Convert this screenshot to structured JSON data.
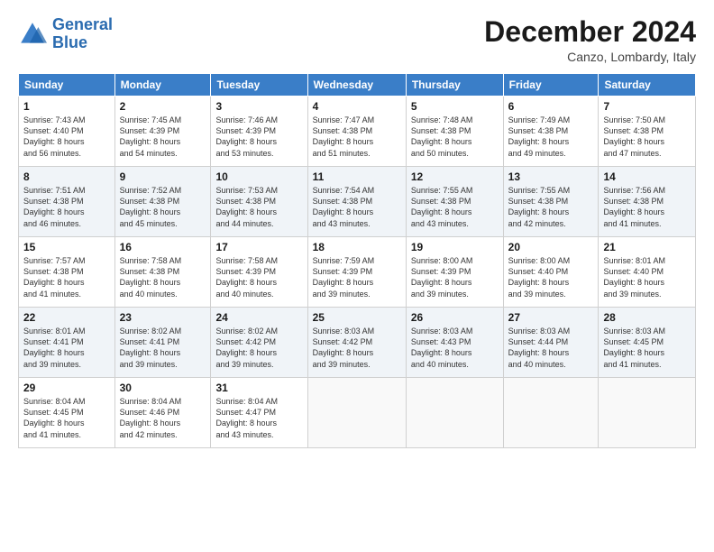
{
  "logo": {
    "line1": "General",
    "line2": "Blue"
  },
  "title": "December 2024",
  "location": "Canzo, Lombardy, Italy",
  "weekdays": [
    "Sunday",
    "Monday",
    "Tuesday",
    "Wednesday",
    "Thursday",
    "Friday",
    "Saturday"
  ],
  "weeks": [
    [
      {
        "day": "1",
        "info": "Sunrise: 7:43 AM\nSunset: 4:40 PM\nDaylight: 8 hours\nand 56 minutes."
      },
      {
        "day": "2",
        "info": "Sunrise: 7:45 AM\nSunset: 4:39 PM\nDaylight: 8 hours\nand 54 minutes."
      },
      {
        "day": "3",
        "info": "Sunrise: 7:46 AM\nSunset: 4:39 PM\nDaylight: 8 hours\nand 53 minutes."
      },
      {
        "day": "4",
        "info": "Sunrise: 7:47 AM\nSunset: 4:38 PM\nDaylight: 8 hours\nand 51 minutes."
      },
      {
        "day": "5",
        "info": "Sunrise: 7:48 AM\nSunset: 4:38 PM\nDaylight: 8 hours\nand 50 minutes."
      },
      {
        "day": "6",
        "info": "Sunrise: 7:49 AM\nSunset: 4:38 PM\nDaylight: 8 hours\nand 49 minutes."
      },
      {
        "day": "7",
        "info": "Sunrise: 7:50 AM\nSunset: 4:38 PM\nDaylight: 8 hours\nand 47 minutes."
      }
    ],
    [
      {
        "day": "8",
        "info": "Sunrise: 7:51 AM\nSunset: 4:38 PM\nDaylight: 8 hours\nand 46 minutes."
      },
      {
        "day": "9",
        "info": "Sunrise: 7:52 AM\nSunset: 4:38 PM\nDaylight: 8 hours\nand 45 minutes."
      },
      {
        "day": "10",
        "info": "Sunrise: 7:53 AM\nSunset: 4:38 PM\nDaylight: 8 hours\nand 44 minutes."
      },
      {
        "day": "11",
        "info": "Sunrise: 7:54 AM\nSunset: 4:38 PM\nDaylight: 8 hours\nand 43 minutes."
      },
      {
        "day": "12",
        "info": "Sunrise: 7:55 AM\nSunset: 4:38 PM\nDaylight: 8 hours\nand 43 minutes."
      },
      {
        "day": "13",
        "info": "Sunrise: 7:55 AM\nSunset: 4:38 PM\nDaylight: 8 hours\nand 42 minutes."
      },
      {
        "day": "14",
        "info": "Sunrise: 7:56 AM\nSunset: 4:38 PM\nDaylight: 8 hours\nand 41 minutes."
      }
    ],
    [
      {
        "day": "15",
        "info": "Sunrise: 7:57 AM\nSunset: 4:38 PM\nDaylight: 8 hours\nand 41 minutes."
      },
      {
        "day": "16",
        "info": "Sunrise: 7:58 AM\nSunset: 4:38 PM\nDaylight: 8 hours\nand 40 minutes."
      },
      {
        "day": "17",
        "info": "Sunrise: 7:58 AM\nSunset: 4:39 PM\nDaylight: 8 hours\nand 40 minutes."
      },
      {
        "day": "18",
        "info": "Sunrise: 7:59 AM\nSunset: 4:39 PM\nDaylight: 8 hours\nand 39 minutes."
      },
      {
        "day": "19",
        "info": "Sunrise: 8:00 AM\nSunset: 4:39 PM\nDaylight: 8 hours\nand 39 minutes."
      },
      {
        "day": "20",
        "info": "Sunrise: 8:00 AM\nSunset: 4:40 PM\nDaylight: 8 hours\nand 39 minutes."
      },
      {
        "day": "21",
        "info": "Sunrise: 8:01 AM\nSunset: 4:40 PM\nDaylight: 8 hours\nand 39 minutes."
      }
    ],
    [
      {
        "day": "22",
        "info": "Sunrise: 8:01 AM\nSunset: 4:41 PM\nDaylight: 8 hours\nand 39 minutes."
      },
      {
        "day": "23",
        "info": "Sunrise: 8:02 AM\nSunset: 4:41 PM\nDaylight: 8 hours\nand 39 minutes."
      },
      {
        "day": "24",
        "info": "Sunrise: 8:02 AM\nSunset: 4:42 PM\nDaylight: 8 hours\nand 39 minutes."
      },
      {
        "day": "25",
        "info": "Sunrise: 8:03 AM\nSunset: 4:42 PM\nDaylight: 8 hours\nand 39 minutes."
      },
      {
        "day": "26",
        "info": "Sunrise: 8:03 AM\nSunset: 4:43 PM\nDaylight: 8 hours\nand 40 minutes."
      },
      {
        "day": "27",
        "info": "Sunrise: 8:03 AM\nSunset: 4:44 PM\nDaylight: 8 hours\nand 40 minutes."
      },
      {
        "day": "28",
        "info": "Sunrise: 8:03 AM\nSunset: 4:45 PM\nDaylight: 8 hours\nand 41 minutes."
      }
    ],
    [
      {
        "day": "29",
        "info": "Sunrise: 8:04 AM\nSunset: 4:45 PM\nDaylight: 8 hours\nand 41 minutes."
      },
      {
        "day": "30",
        "info": "Sunrise: 8:04 AM\nSunset: 4:46 PM\nDaylight: 8 hours\nand 42 minutes."
      },
      {
        "day": "31",
        "info": "Sunrise: 8:04 AM\nSunset: 4:47 PM\nDaylight: 8 hours\nand 43 minutes."
      },
      null,
      null,
      null,
      null
    ]
  ]
}
